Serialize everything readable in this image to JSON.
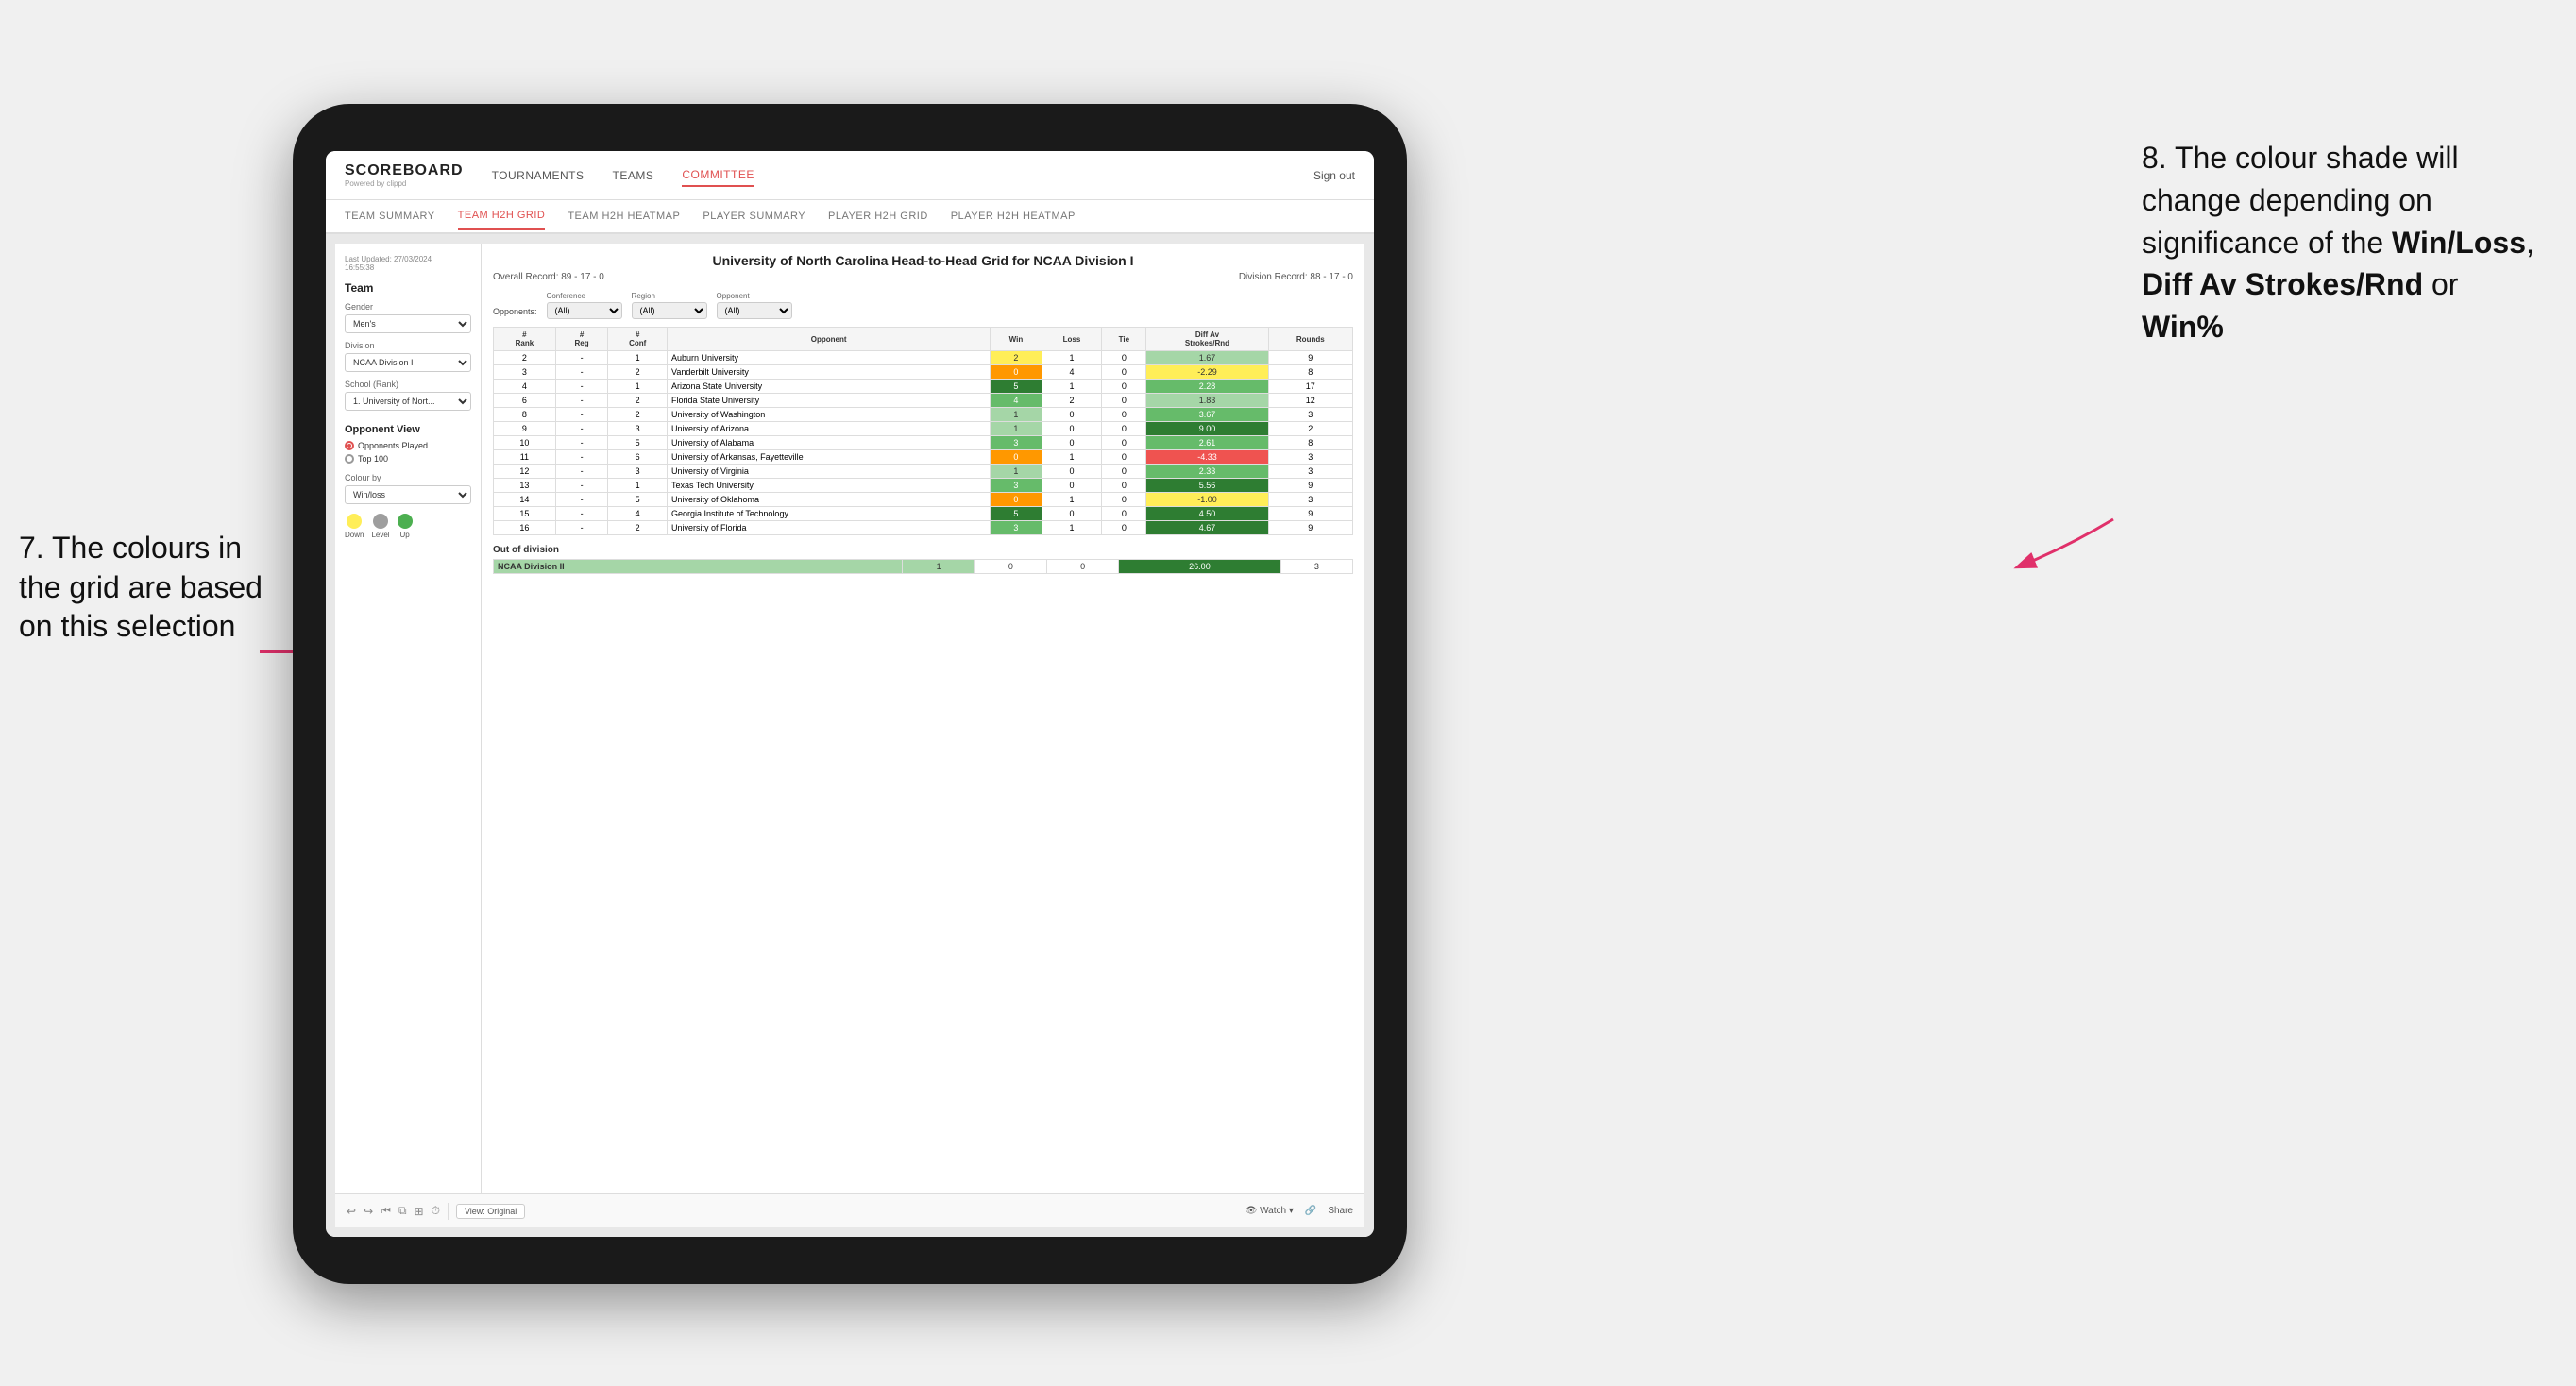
{
  "annotations": {
    "left_text": "7. The colours in the grid are based on this selection",
    "right_text_line1": "8. The colour shade will change depending on significance of the ",
    "right_bold1": "Win/Loss",
    "right_comma": ", ",
    "right_bold2": "Diff Av Strokes/Rnd",
    "right_or": " or ",
    "right_bold3": "Win%"
  },
  "header": {
    "logo": "SCOREBOARD",
    "logo_sub": "Powered by clippd",
    "nav_items": [
      "TOURNAMENTS",
      "TEAMS",
      "COMMITTEE"
    ],
    "sign_out": "Sign out"
  },
  "sub_nav": {
    "items": [
      "TEAM SUMMARY",
      "TEAM H2H GRID",
      "TEAM H2H HEATMAP",
      "PLAYER SUMMARY",
      "PLAYER H2H GRID",
      "PLAYER H2H HEATMAP"
    ],
    "active": "TEAM H2H GRID"
  },
  "left_panel": {
    "timestamp_label": "Last Updated: 27/03/2024",
    "timestamp_time": "16:55:38",
    "team_label": "Team",
    "gender_label": "Gender",
    "gender_value": "Men's",
    "division_label": "Division",
    "division_value": "NCAA Division I",
    "school_label": "School (Rank)",
    "school_value": "1. University of Nort...",
    "opponent_view_label": "Opponent View",
    "radio1": "Opponents Played",
    "radio2": "Top 100",
    "radio1_selected": true,
    "colour_by_label": "Colour by",
    "colour_by_value": "Win/loss",
    "legend": {
      "down_label": "Down",
      "down_color": "#ffee58",
      "level_label": "Level",
      "level_color": "#9e9e9e",
      "up_label": "Up",
      "up_color": "#4caf50"
    }
  },
  "grid": {
    "title": "University of North Carolina Head-to-Head Grid for NCAA Division I",
    "overall_record": "Overall Record: 89 - 17 - 0",
    "division_record": "Division Record: 88 - 17 - 0",
    "filters": {
      "opponents_label": "Opponents:",
      "conference_label": "Conference",
      "conference_value": "(All)",
      "region_label": "Region",
      "region_value": "(All)",
      "opponent_label": "Opponent",
      "opponent_value": "(All)"
    },
    "columns": [
      "#\nRank",
      "#\nReg",
      "#\nConf",
      "Opponent",
      "Win",
      "Loss",
      "Tie",
      "Diff Av\nStrokes/Rnd",
      "Rounds"
    ],
    "rows": [
      {
        "rank": "2",
        "reg": "-",
        "conf": "1",
        "opponent": "Auburn University",
        "win": "2",
        "loss": "1",
        "tie": "0",
        "diff": "1.67",
        "rounds": "9",
        "win_color": "yellow",
        "diff_color": "green_light"
      },
      {
        "rank": "3",
        "reg": "-",
        "conf": "2",
        "opponent": "Vanderbilt University",
        "win": "0",
        "loss": "4",
        "tie": "0",
        "diff": "-2.29",
        "rounds": "8",
        "win_color": "orange",
        "diff_color": "yellow"
      },
      {
        "rank": "4",
        "reg": "-",
        "conf": "1",
        "opponent": "Arizona State University",
        "win": "5",
        "loss": "1",
        "tie": "0",
        "diff": "2.28",
        "rounds": "17",
        "win_color": "green_dark",
        "diff_color": "green_med"
      },
      {
        "rank": "6",
        "reg": "-",
        "conf": "2",
        "opponent": "Florida State University",
        "win": "4",
        "loss": "2",
        "tie": "0",
        "diff": "1.83",
        "rounds": "12",
        "win_color": "green_med",
        "diff_color": "green_light"
      },
      {
        "rank": "8",
        "reg": "-",
        "conf": "2",
        "opponent": "University of Washington",
        "win": "1",
        "loss": "0",
        "tie": "0",
        "diff": "3.67",
        "rounds": "3",
        "win_color": "green_light",
        "diff_color": "green_med"
      },
      {
        "rank": "9",
        "reg": "-",
        "conf": "3",
        "opponent": "University of Arizona",
        "win": "1",
        "loss": "0",
        "tie": "0",
        "diff": "9.00",
        "rounds": "2",
        "win_color": "green_light",
        "diff_color": "green_dark"
      },
      {
        "rank": "10",
        "reg": "-",
        "conf": "5",
        "opponent": "University of Alabama",
        "win": "3",
        "loss": "0",
        "tie": "0",
        "diff": "2.61",
        "rounds": "8",
        "win_color": "green_med",
        "diff_color": "green_med"
      },
      {
        "rank": "11",
        "reg": "-",
        "conf": "6",
        "opponent": "University of Arkansas, Fayetteville",
        "win": "0",
        "loss": "1",
        "tie": "0",
        "diff": "-4.33",
        "rounds": "3",
        "win_color": "orange",
        "diff_color": "red"
      },
      {
        "rank": "12",
        "reg": "-",
        "conf": "3",
        "opponent": "University of Virginia",
        "win": "1",
        "loss": "0",
        "tie": "0",
        "diff": "2.33",
        "rounds": "3",
        "win_color": "green_light",
        "diff_color": "green_med"
      },
      {
        "rank": "13",
        "reg": "-",
        "conf": "1",
        "opponent": "Texas Tech University",
        "win": "3",
        "loss": "0",
        "tie": "0",
        "diff": "5.56",
        "rounds": "9",
        "win_color": "green_med",
        "diff_color": "green_dark"
      },
      {
        "rank": "14",
        "reg": "-",
        "conf": "5",
        "opponent": "University of Oklahoma",
        "win": "0",
        "loss": "1",
        "tie": "0",
        "diff": "-1.00",
        "rounds": "3",
        "win_color": "orange",
        "diff_color": "yellow"
      },
      {
        "rank": "15",
        "reg": "-",
        "conf": "4",
        "opponent": "Georgia Institute of Technology",
        "win": "5",
        "loss": "0",
        "tie": "0",
        "diff": "4.50",
        "rounds": "9",
        "win_color": "green_dark",
        "diff_color": "green_dark"
      },
      {
        "rank": "16",
        "reg": "-",
        "conf": "2",
        "opponent": "University of Florida",
        "win": "3",
        "loss": "1",
        "tie": "0",
        "diff": "4.67",
        "rounds": "9",
        "win_color": "green_med",
        "diff_color": "green_dark"
      }
    ],
    "out_of_division_label": "Out of division",
    "ood_rows": [
      {
        "division": "NCAA Division II",
        "win": "1",
        "loss": "0",
        "tie": "0",
        "diff": "26.00",
        "rounds": "3",
        "win_color": "green_light",
        "diff_color": "green_dark"
      }
    ]
  },
  "toolbar": {
    "view_label": "View: Original",
    "watch_label": "Watch",
    "share_label": "Share"
  }
}
